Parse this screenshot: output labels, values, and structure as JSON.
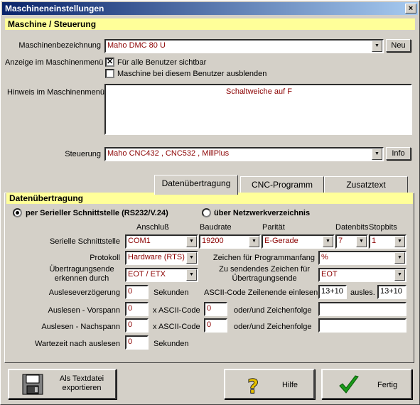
{
  "window": {
    "title": "Maschineneinstellungen",
    "close_glyph": "×"
  },
  "section_machine": {
    "title": "Maschine / Steuerung"
  },
  "machine": {
    "name_label": "Maschinenbezeichnung",
    "name_value": "Maho DMC 80 U",
    "new_button": "Neu",
    "menu_label": "Anzeige im Maschinenmenü",
    "visible_all_label": "Für alle Benutzer sichtbar",
    "visible_all_checked": true,
    "hide_label": "Maschine bei diesem Benutzer ausblenden",
    "hide_checked": false,
    "hint_label": "Hinweis im Maschinenmenü",
    "hint_value": "Schaltweiche auf F",
    "control_label": "Steuerung",
    "control_value": "Maho CNC432 , CNC532 , MillPlus",
    "info_button": "Info"
  },
  "tabs": [
    {
      "label": "Datenübertragung",
      "active": true
    },
    {
      "label": "CNC-Programm",
      "active": false
    },
    {
      "label": "Zusatztext",
      "active": false
    }
  ],
  "transfer": {
    "title": "Datenübertragung",
    "radio_serial": "per Serieller Schnittstelle (RS232/V.24)",
    "radio_network": "über Netzwerkverzeichnis",
    "serial_selected": true,
    "col_port": "Anschluß",
    "col_baud": "Baudrate",
    "col_parity": "Parität",
    "col_databits": "Datenbits",
    "col_stopbits": "Stopbits",
    "serial_label": "Serielle Schnittstelle",
    "port": "COM1",
    "baud": "19200",
    "parity": "E-Gerade",
    "databits": "7",
    "stopbits": "1",
    "protocol_label": "Protokoll",
    "protocol": "Hardware (RTS)",
    "start_char_label": "Zeichen für Programmanfang",
    "start_char": "%",
    "end_detect_label": "Übertragungsende erkennen durch",
    "end_detect": "EOT / ETX",
    "end_char_label": "Zu sendendes Zeichen für Übertragungsende",
    "end_char": "EOT",
    "delay_label": "Ausleseverzögerung",
    "delay_value": "0",
    "seconds": "Sekunden",
    "ascii_end_label": "ASCII-Code Zeilenende einlesen",
    "ascii_end_in": "13+10",
    "ausles_label": "ausles.",
    "ascii_end_out": "13+10",
    "prefix_label": "Auslesen - Vorspann",
    "prefix_value": "0",
    "ascii_code": "x ASCII-Code",
    "prefix_code": "0",
    "or_seq": "oder/und Zeichenfolge",
    "prefix_seq": "",
    "suffix_label": "Auslesen - Nachspann",
    "suffix_value": "0",
    "suffix_code": "0",
    "suffix_seq": "",
    "wait_label": "Wartezeit nach auslesen",
    "wait_value": "0"
  },
  "footer": {
    "export_label": "Als Textdatei exportieren",
    "help_label": "Hilfe",
    "done_label": "Fertig"
  },
  "colors": {
    "title_start": "#0a246a",
    "title_end": "#a6caf0",
    "header_yellow": "#ffff99",
    "value_red": "#8b0000"
  }
}
